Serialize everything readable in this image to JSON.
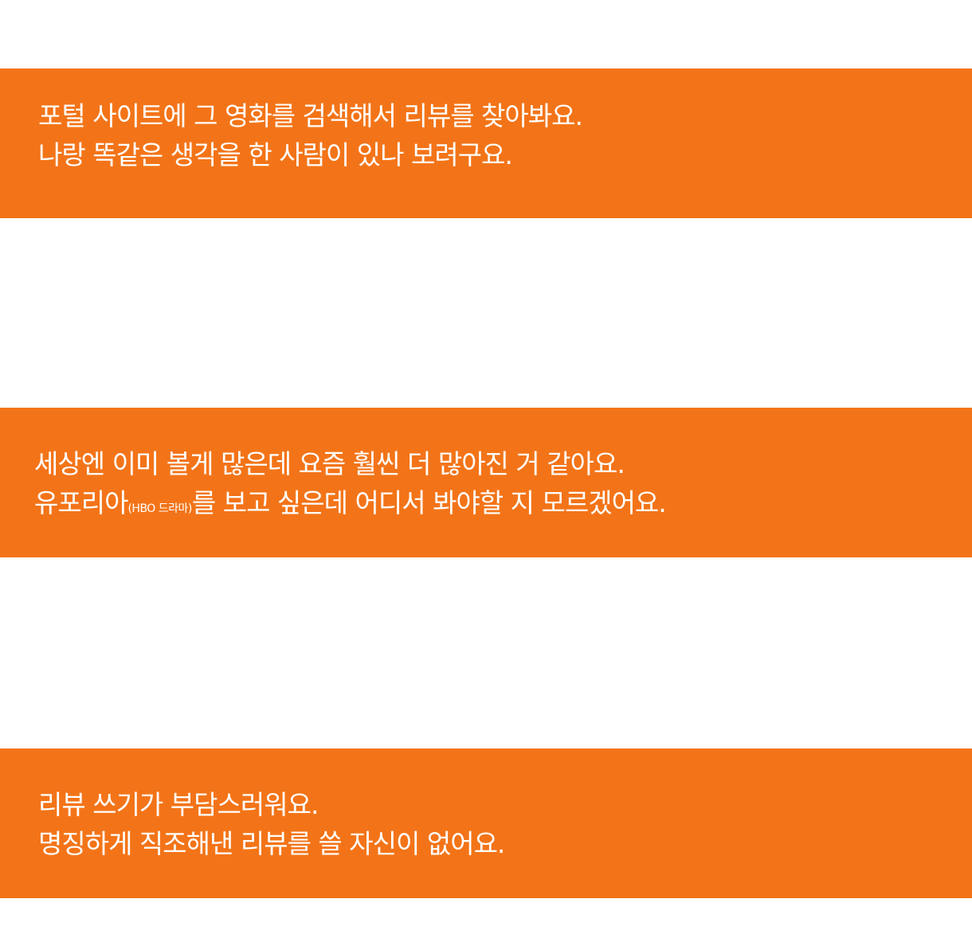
{
  "colors": {
    "background": "#ffffff",
    "banner": "#f37418",
    "text": "#ffffff"
  },
  "banners": [
    {
      "lines": [
        "포털 사이트에 그 영화를 검색해서 리뷰를 찾아봐요.",
        "나랑 똑같은 생각을 한 사람이 있나 보려구요."
      ]
    },
    {
      "line1": "세상엔 이미 볼게 많은데 요즘 훨씬 더 많아진 거 같아요.",
      "line2_before": "유포리아",
      "line2_note": "(HBO 드라마)",
      "line2_after": "를 보고 싶은데 어디서 봐야할 지 모르겠어요."
    },
    {
      "lines": [
        "리뷰 쓰기가 부담스러워요.",
        "명징하게 직조해낸 리뷰를 쓸 자신이 없어요."
      ]
    }
  ]
}
